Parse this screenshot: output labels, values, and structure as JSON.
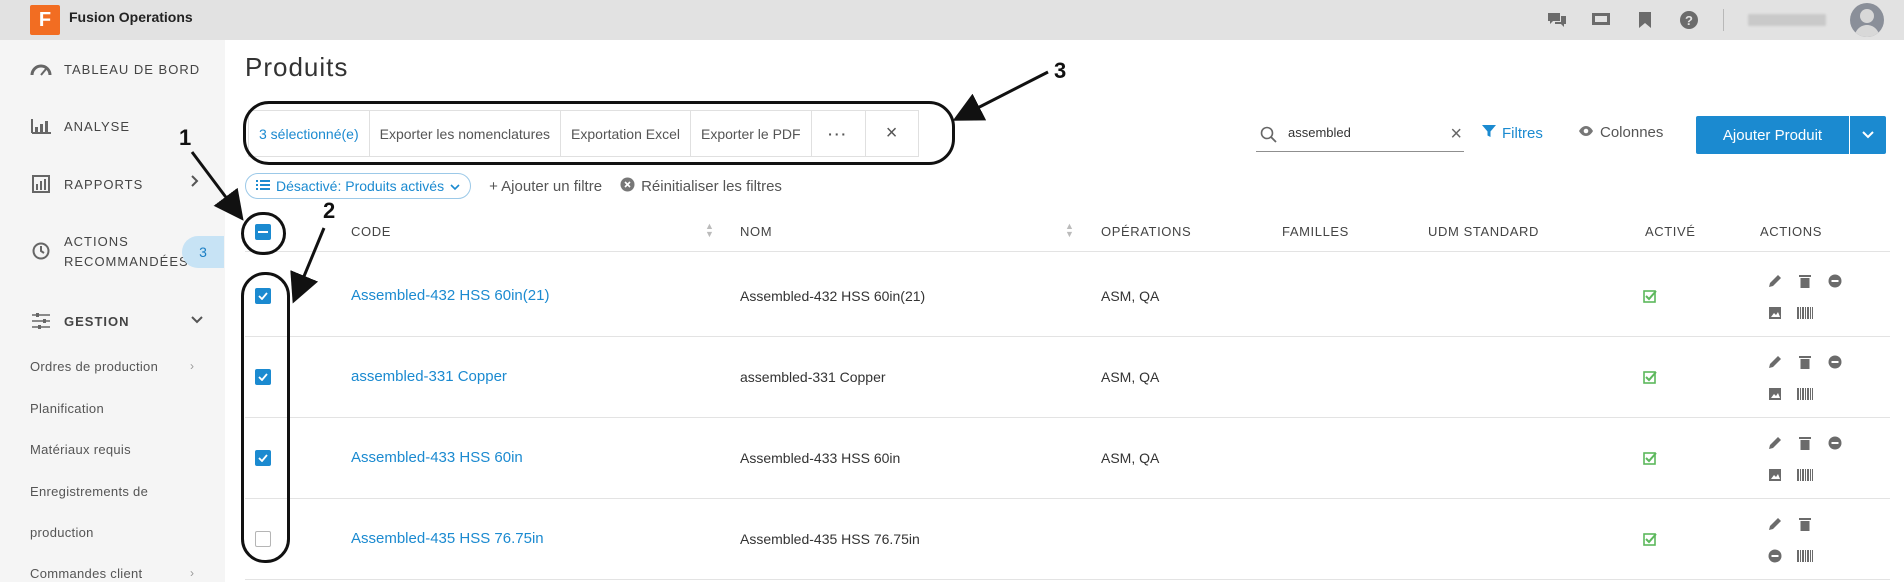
{
  "app": {
    "logo_letter": "F",
    "title": "Fusion Operations"
  },
  "sidebar": {
    "items": [
      {
        "label": "TABLEAU DE BORD",
        "icon": "gauge-icon"
      },
      {
        "label": "ANALYSE",
        "icon": "chart-icon"
      },
      {
        "label": "RAPPORTS",
        "icon": "report-icon"
      },
      {
        "label": "ACTIONS",
        "label2": "RECOMMANDÉES",
        "icon": "history-icon",
        "badge": "3"
      },
      {
        "label": "GESTION",
        "icon": "sliders-icon"
      }
    ],
    "subitems": [
      {
        "label": "Ordres de production"
      },
      {
        "label": "Planification"
      },
      {
        "label": "Matériaux requis"
      },
      {
        "label": "Enregistrements de"
      },
      {
        "label": "production"
      },
      {
        "label": "Commandes client"
      }
    ]
  },
  "page": {
    "title": "Produits"
  },
  "bulk": {
    "selected": "3 sélectionné(e)",
    "export_bom": "Exporter les nomenclatures",
    "export_excel": "Exportation Excel",
    "export_pdf": "Exporter le PDF",
    "more": "···",
    "close": "×"
  },
  "search": {
    "value": "assembled",
    "clear": "×"
  },
  "toolbar": {
    "filters": "Filtres",
    "columns": "Colonnes",
    "add": "Ajouter Produit"
  },
  "filters": {
    "chip": "Désactivé: Produits activés",
    "add": "+ Ajouter un filtre",
    "reset": "Réinitialiser les filtres"
  },
  "table": {
    "headers": {
      "code": "CODE",
      "nom": "NOM",
      "operations": "OPÉRATIONS",
      "familles": "FAMILLES",
      "udm": "UDM STANDARD",
      "active": "ACTIVÉ",
      "actions": "ACTIONS"
    },
    "rows": [
      {
        "code": "Assembled-432 HSS 60in(21)",
        "nom": "Assembled-432 HSS 60in(21)",
        "ops": "ASM, QA",
        "checked": true
      },
      {
        "code": "assembled-331 Copper",
        "nom": "assembled-331 Copper",
        "ops": "ASM, QA",
        "checked": true
      },
      {
        "code": "Assembled-433 HSS 60in",
        "nom": "Assembled-433 HSS 60in",
        "ops": "ASM, QA",
        "checked": true
      },
      {
        "code": "Assembled-435 HSS 76.75in",
        "nom": "Assembled-435 HSS 76.75in",
        "ops": "",
        "checked": false
      }
    ]
  },
  "annotations": {
    "n1": "1",
    "n2": "2",
    "n3": "3"
  },
  "colors": {
    "accent": "#1b8ad0",
    "logo": "#f26d22",
    "active_green": "#5cb85c"
  }
}
